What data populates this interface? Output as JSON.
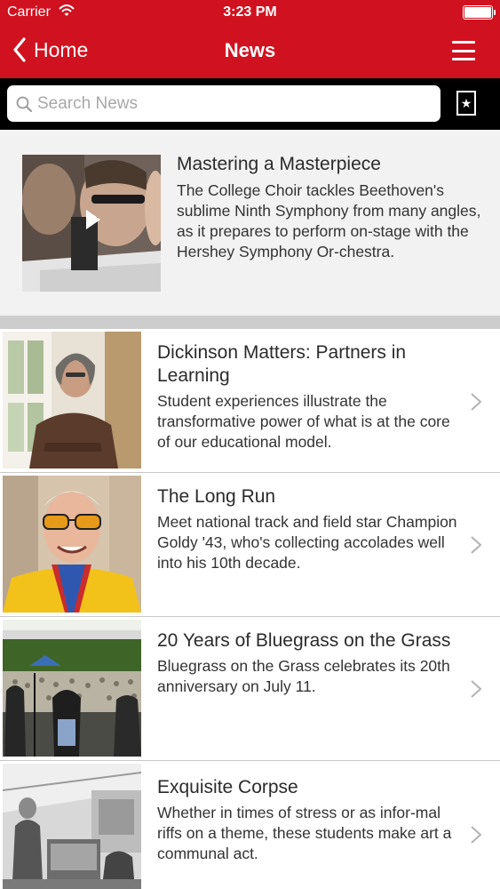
{
  "status_bar": {
    "carrier": "Carrier",
    "time": "3:23 PM"
  },
  "nav": {
    "back_label": "Home",
    "title": "News"
  },
  "search": {
    "placeholder": "Search News"
  },
  "featured": {
    "title": "Mastering a Masterpiece",
    "description": "The College Choir tackles Beethoven's sublime Ninth Symphony from many angles, as it prepares to perform on-stage with the Hershey Symphony Or-chestra."
  },
  "articles": [
    {
      "title": "Dickinson Matters: Partners in Learning",
      "description": "Student experiences illustrate the transformative power of what is at the core of our educational model."
    },
    {
      "title": "The Long Run",
      "description": "Meet national track and field star Champion Goldy '43, who's collecting accolades well into his 10th decade."
    },
    {
      "title": "20 Years of Bluegrass on the Grass",
      "description": "Bluegrass on the Grass celebrates its 20th anniversary on July 11."
    },
    {
      "title": "Exquisite Corpse",
      "description": "Whether in times of stress or as infor-mal riffs on a theme, these students make art a communal act."
    }
  ],
  "colors": {
    "brand_red": "#d0111f",
    "search_bar_bg": "#000000",
    "featured_bg": "#f2f2f2",
    "divider_band": "#cdcdcd"
  },
  "icons": [
    "wifi-icon",
    "battery-icon",
    "back-chevron-icon",
    "hamburger-menu-icon",
    "search-icon",
    "bookmark-star-icon",
    "play-icon",
    "chevron-right-icon"
  ]
}
